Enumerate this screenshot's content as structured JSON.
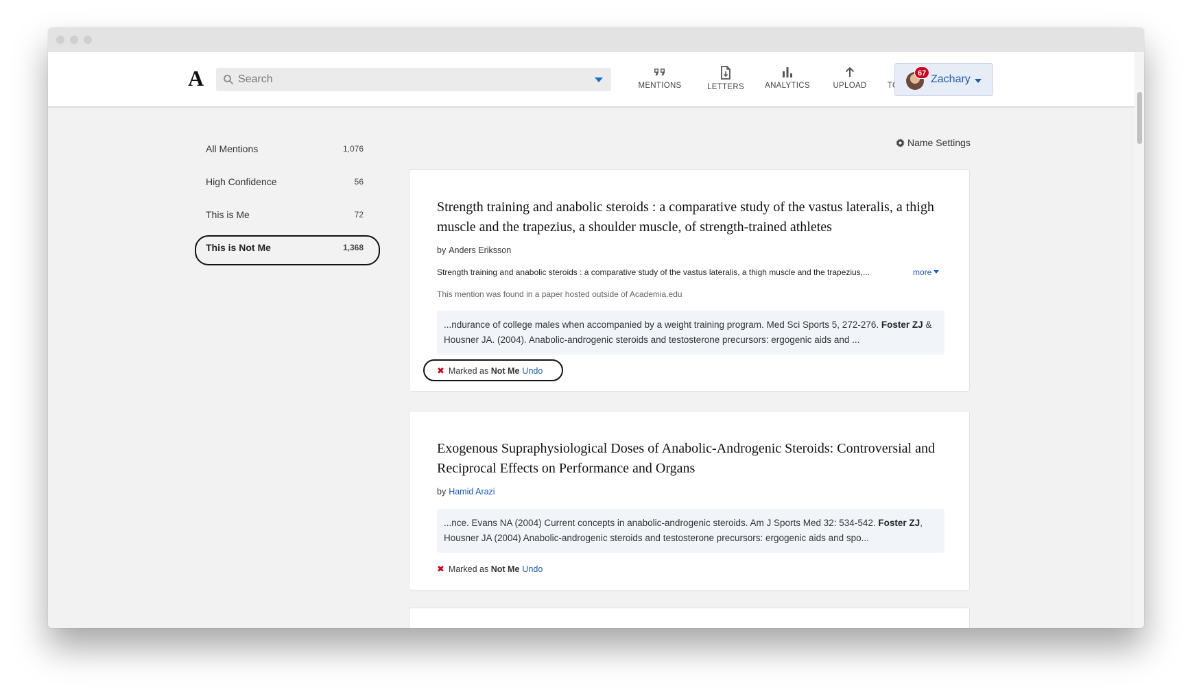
{
  "header": {
    "logo": "A",
    "search_placeholder": "Search",
    "nav": [
      {
        "label": "MENTIONS",
        "icon": "quote-icon"
      },
      {
        "label": "LETTERS",
        "icon": "letter-document-icon"
      },
      {
        "label": "ANALYTICS",
        "icon": "bar-chart-icon"
      },
      {
        "label": "UPLOAD",
        "icon": "upload-arrow-icon"
      },
      {
        "label": "TOOLS",
        "icon": "grid-icon"
      }
    ],
    "user": {
      "name": "Zachary",
      "notification_count": "67"
    }
  },
  "sidebar": {
    "items": [
      {
        "label": "All Mentions",
        "count": "1,076"
      },
      {
        "label": "High Confidence",
        "count": "56"
      },
      {
        "label": "This is Me",
        "count": "72"
      },
      {
        "label": "This is Not Me",
        "count": "1,368",
        "active": true
      }
    ]
  },
  "name_settings": "Name Settings",
  "cards": [
    {
      "title": "Strength training and anabolic steroids : a comparative study of the vastus lateralis, a thigh muscle and the trapezius, a shoulder muscle, of strength-trained athletes",
      "by": "by",
      "author": "Anders Eriksson",
      "abstract": "Strength training and anabolic steroids : a comparative study of the vastus lateralis, a thigh muscle and the trapezius,...",
      "more": "more",
      "hosted_note": "This mention was found in a paper hosted outside of Academia.edu",
      "snippet_pre": "...ndurance of college males when accompanied by a weight training program. Med Sci Sports 5, 272-276. ",
      "snippet_bold": "Foster ZJ",
      "snippet_post": " & Housner JA. (2004). Anabolic-androgenic steroids and testosterone precursors: ergogenic aids and ...",
      "marked_prefix": "Marked as",
      "marked_bold": "Not Me",
      "undo": "Undo"
    },
    {
      "title": "Exogenous Supraphysiological Doses of Anabolic-Androgenic Steroids: Controversial and Reciprocal Effects on Performance and Organs",
      "by": "by",
      "author": "Hamid Arazi",
      "snippet_pre": "...nce. Evans NA (2004) Current concepts in anabolic-androgenic steroids. Am J Sports Med 32: 534-542. ",
      "snippet_bold": "Foster ZJ",
      "snippet_post": ", Housner JA (2004) Anabolic-androgenic steroids and testosterone precursors: ergogenic aids and spo...",
      "marked_prefix": "Marked as",
      "marked_bold": "Not Me",
      "undo": "Undo"
    }
  ]
}
